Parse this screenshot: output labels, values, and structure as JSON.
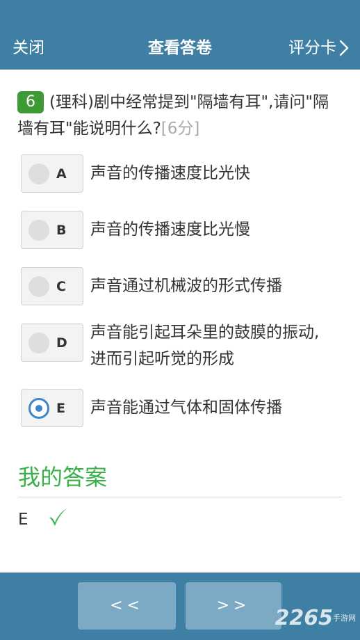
{
  "header": {
    "close_label": "关闭",
    "title": "查看答卷",
    "score_card_label": "评分卡"
  },
  "question": {
    "number": "6",
    "text": "(理科)剧中经常提到\"隔墙有耳\",请问\"隔墙有耳\"能说明什么?",
    "score": "[6分]"
  },
  "options": [
    {
      "letter": "A",
      "text": "声音的传播速度比光快",
      "selected": false
    },
    {
      "letter": "B",
      "text": "声音的传播速度比光慢",
      "selected": false
    },
    {
      "letter": "C",
      "text": "声音通过机械波的形式传播",
      "selected": false
    },
    {
      "letter": "D",
      "text": "声音能引起耳朵里的鼓膜的振动,进而引起听觉的形成",
      "selected": false
    },
    {
      "letter": "E",
      "text": "声音能通过气体和固体传播",
      "selected": true
    }
  ],
  "my_answer": {
    "title": "我的答案",
    "value": "E",
    "status_icon": "check-icon"
  },
  "footer": {
    "prev_label": "<<",
    "next_label": ">>",
    "watermark": "2265",
    "watermark_sub": "手游网"
  },
  "colors": {
    "header_bg": "#3f7fa3",
    "question_badge": "#3d9b35",
    "answer_title": "#3bb14a",
    "selected_radio": "#3b86c6",
    "nav_button": "#7ca9c3"
  }
}
